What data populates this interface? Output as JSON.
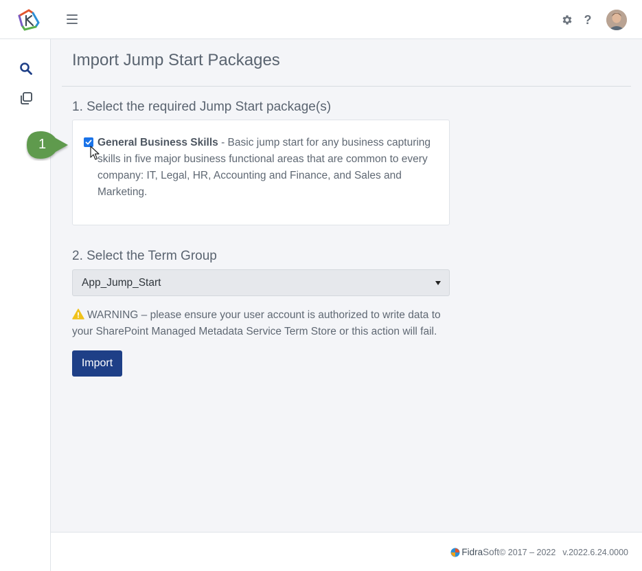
{
  "header": {
    "settings_icon": "gear-icon",
    "help_label": "?",
    "avatar_icon": "avatar"
  },
  "sidebar": {
    "items": [
      {
        "icon": "search-icon"
      },
      {
        "icon": "copy-icon"
      }
    ]
  },
  "main": {
    "title": "Import Jump Start Packages",
    "step1_title": "1. Select the required Jump Start package(s)",
    "package": {
      "name": "General Business Skills",
      "description": " - Basic jump start for any business capturing skills in five major business functional areas that are common to every company: IT, Legal, HR, Accounting and Finance, and Sales and Marketing.",
      "checked": true
    },
    "step2_title": "2. Select the Term Group",
    "term_group_value": "App_Jump_Start",
    "warning_text": "WARNING – please ensure your user account is authorized to write data to your SharePoint Managed Metadata Service Term Store or this action will fail.",
    "import_label": "Import"
  },
  "overlay": {
    "step_badge": "1"
  },
  "footer": {
    "brand_bold": "Fidra",
    "brand_light": "Soft",
    "copyright": "© 2017 – 2022",
    "version": "v.2022.6.24.0000"
  },
  "colors": {
    "primary": "#1e3f87",
    "checkbox": "#1a73e8",
    "badge": "#5f9a4e",
    "warning": "#f0c21b"
  }
}
